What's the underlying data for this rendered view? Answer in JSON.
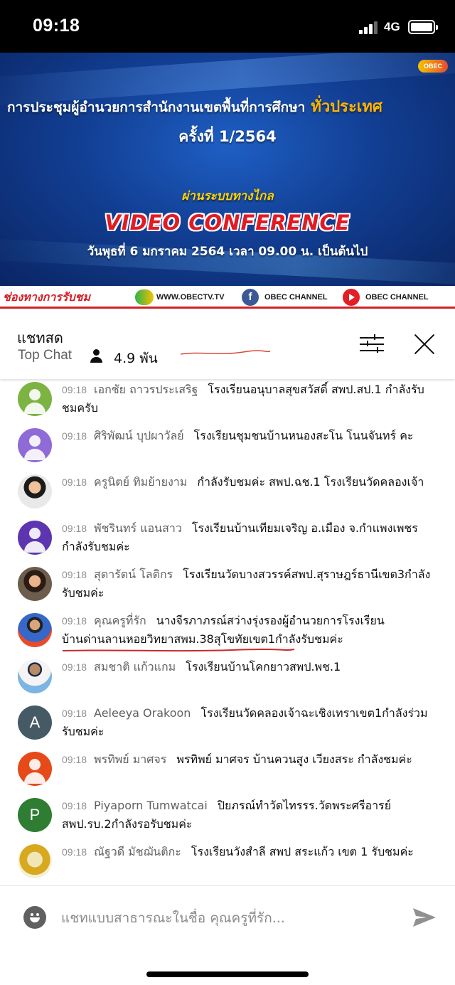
{
  "status_bar": {
    "time": "09:18",
    "network": "4G"
  },
  "video": {
    "logo": "OBEC",
    "title_main": "การประชุมผู้อำนวยการสำนักงานเขตพื้นที่การศึกษา",
    "title_accent": "ทั่วประเทศ",
    "subtitle": "ครั้งที่ 1/2564",
    "remote_label": "ผ่านระบบทางไกล",
    "conference_label": "VIDEO CONFERENCE",
    "date_line": "วันพุธที่ 6 มกราคม 2564 เวลา 09.00 น. เป็นต้นไป",
    "channels_label": "ช่องทางการรับชม",
    "channels": [
      "WWW.OBECTV.TV",
      "OBEC CHANNEL",
      "OBEC CHANNEL"
    ]
  },
  "chat_header": {
    "title": "แชทสด",
    "mode": "Top Chat",
    "viewer_count": "4.9 พัน",
    "icons": {
      "viewers": "person-icon",
      "filter": "sliders-icon",
      "close": "close-icon"
    }
  },
  "messages": [
    {
      "time": "09:18",
      "author": "เอกชัย ถาวรประเสริฐ",
      "text": "โรงเรียนอนุบาลสุขสวัสดิ์ สพป.สป.1 กำลังรับชมครับ",
      "avatar": "default",
      "avatar_color": "#7cb342"
    },
    {
      "time": "09:18",
      "author": "ศิริพัฒน์ บุปผาวัลย์",
      "text": "โรงเรียนชุมชนบ้านหนองสะโน โนนจันทร์ คะ",
      "avatar": "default",
      "avatar_color": "#8e6bd6"
    },
    {
      "time": "09:18",
      "author": "ครูนิตย์ ทิมย้ายงาม",
      "text": "กำลังรับชมค่ะ สพป.ฉช.1 โรงเรียนวัดคลองเจ้า",
      "avatar": "photo-f1"
    },
    {
      "time": "09:18",
      "author": "พัชรินทร์ แอนสาว",
      "text": "โรงเรียนบ้านเทียมเจริญ อ.เมือง จ.กำแพงเพชร กำลังรับชมค่ะ",
      "avatar": "default",
      "avatar_color": "#5e35b1"
    },
    {
      "time": "09:18",
      "author": "สุดารัตน์ โลติกร",
      "text": "โรงเรียนวัดบางสวรรค์สพป.สุราษฎร์ธานีเขต3กำลังรับชมค่ะ",
      "avatar": "photo-f2"
    },
    {
      "time": "09:18",
      "author": "คุณครูที่รัก",
      "text": "นางจีรภาภรณ์สว่างรุ่งรองผู้อำนวยการโรงเรียนบ้านด่านลานหอยวิทยาสพม.38สุโขทัยเขต1กำลังรับชมค่ะ",
      "avatar": "photo-f3"
    },
    {
      "time": "09:18",
      "author": "สมชาติ แก้วแกม",
      "text": "โรงเรียนบ้านโคกยาวสพป.พช.1",
      "avatar": "photo-m1"
    },
    {
      "time": "09:18",
      "author": "Aeleeya Orakoon",
      "text": "โรงเรียนวัดคลองเจ้าฉะเชิงเทราเขต1กำลังร่วมรับชมค่ะ",
      "avatar": "letter",
      "avatar_letter": "A",
      "avatar_color": "#455a64"
    },
    {
      "time": "09:18",
      "author": "พรทิพย์ มาศจร",
      "text": "พรทิพย์ มาศจร บ้านควนสูง เวียงสระ กำลังชมค่ะ",
      "avatar": "default",
      "avatar_color": "#e64a19"
    },
    {
      "time": "09:18",
      "author": "Piyaporn Tumwatcai",
      "text": "ปิยภรณ์ทำวัดไทรรร.วัดพระศรีอารย์ สพป.รบ.2กำลังรอรับชมค่ะ",
      "avatar": "letter",
      "avatar_letter": "P",
      "avatar_color": "#2e7d32"
    },
    {
      "time": "09:18",
      "author": "ณัฐวดี มัชฌันติกะ",
      "text": "โรงเรียนวังสำลี สพป สระแก้ว เขต 1 รับชมค่ะ",
      "avatar": "photo-r"
    }
  ],
  "input_bar": {
    "placeholder": "แชทแบบสาธารณะในชื่อ คุณครูที่รัก...",
    "icons": {
      "emoji": "emoji-icon",
      "send": "send-icon"
    }
  }
}
